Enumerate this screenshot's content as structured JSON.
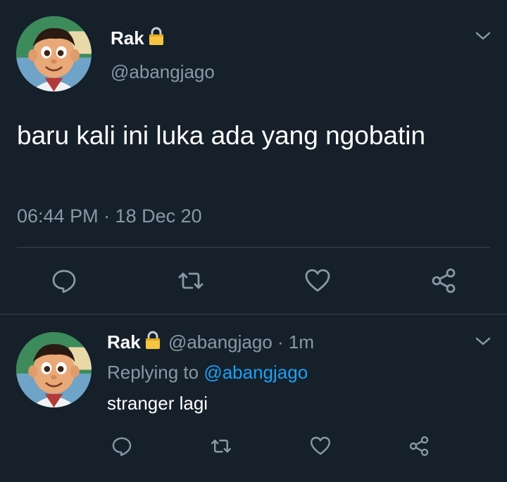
{
  "colors": {
    "background": "#15202b",
    "text_primary": "#ffffff",
    "text_secondary": "#8899a6",
    "divider": "#38444d",
    "link": "#1da1f2",
    "lock": "#f5c542"
  },
  "main_tweet": {
    "display_name": "Rak",
    "handle": "@abangjago",
    "text": "baru kali ini luka ada yang ngobatin",
    "timestamp": "06:44 PM · 18 Dec 20",
    "icons": {
      "lock": "lock-icon",
      "more": "chevron-down-icon",
      "reply": "reply-icon",
      "retweet": "retweet-icon",
      "like": "heart-icon",
      "share": "share-icon"
    }
  },
  "reply_tweet": {
    "display_name": "Rak",
    "handle": "@abangjago",
    "separator": " · ",
    "time_ago": "1m",
    "replying_prefix": "Replying to ",
    "replying_to": "@abangjago",
    "text": "stranger lagi"
  }
}
